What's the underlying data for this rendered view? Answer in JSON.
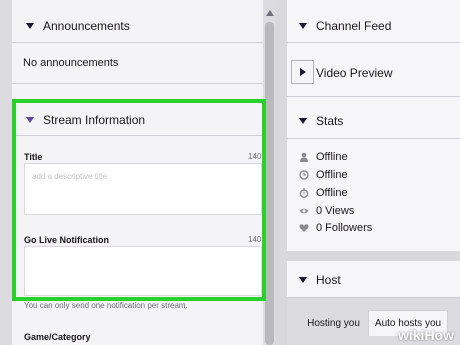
{
  "left": {
    "announcements": {
      "header": "Announcements",
      "body": "No announcements"
    },
    "stream_info": {
      "header": "Stream Information",
      "title_label": "Title",
      "title_count": "140",
      "title_placeholder": "add a descriptive title",
      "go_live_label": "Go Live Notification",
      "go_live_count": "140",
      "note": "You can only send one notification per stream.",
      "game_label": "Game/Category"
    }
  },
  "right": {
    "channel_feed": "Channel Feed",
    "video_preview": "Video Preview",
    "stats": {
      "header": "Stats",
      "items": [
        {
          "icon": "person-icon",
          "label": "Offline"
        },
        {
          "icon": "clock-icon",
          "label": "Offline"
        },
        {
          "icon": "stopwatch-icon",
          "label": "Offline"
        },
        {
          "icon": "eye-icon",
          "label": "0 Views"
        },
        {
          "icon": "heart-icon",
          "label": "0 Followers"
        }
      ]
    },
    "host": {
      "header": "Host",
      "tabs": [
        "Hosting you",
        "Auto hosts you"
      ]
    }
  },
  "watermark": {
    "wiki": "wiki",
    "how": "How"
  },
  "colors": {
    "highlight": "#2bd12b",
    "accent": "#6441a4"
  }
}
